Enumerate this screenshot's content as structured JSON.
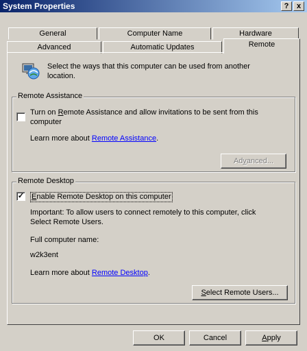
{
  "window": {
    "title": "System Properties",
    "help_label": "?",
    "close_label": "x"
  },
  "tabs": {
    "row1": [
      "General",
      "Computer Name",
      "Hardware"
    ],
    "row2": [
      "Advanced",
      "Automatic Updates",
      "Remote"
    ],
    "active": "Remote"
  },
  "intro": {
    "icon": "computer-network-icon",
    "text_line1": "Select the ways that this computer can be used from another",
    "text_line2": "location."
  },
  "remote_assistance": {
    "label": "Remote Assistance",
    "checkbox_checked": false,
    "checkbox_line1": "Turn on Remote Assistance and allow invitations to be sent from this",
    "checkbox_line2": "computer",
    "learn_prefix": "Learn more about",
    "learn_link": "Remote Assistance",
    "learn_suffix": ".",
    "advanced_button": "Advanced..."
  },
  "remote_desktop": {
    "label": "Remote Desktop",
    "checkbox_checked": true,
    "checkbox_label": "Enable Remote Desktop on this computer",
    "important_line1": "Important: To allow users to connect remotely to this computer, click",
    "important_line2": "Select Remote Users.",
    "full_name_label": "Full computer name:",
    "computer_name": "w2k3ent",
    "learn_prefix": "Learn more about",
    "learn_link": "Remote Desktop",
    "learn_suffix": ".",
    "select_users_button": "Select Remote Users..."
  },
  "footer": {
    "ok": "OK",
    "cancel": "Cancel",
    "apply": "Apply"
  }
}
